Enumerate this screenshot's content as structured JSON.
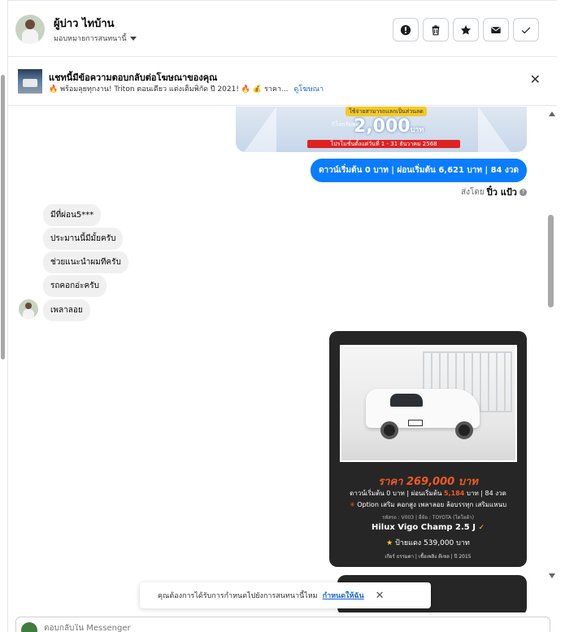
{
  "header": {
    "contact_name": "ผู้บ่าว ไทบ้าน",
    "assign_label": "มอบหมายการสนทนานี้"
  },
  "ad_banner": {
    "title": "แชทนี้มีข้อความตอบกลับต่อโฆษณาของคุณ",
    "subtitle": "🔥 พร้อมลุยทุกงาน! Triton ตอนเดียว แต่งเต็มพิกัด ปี 2021! 🔥 💰 ราคา...",
    "link": "ดูโฆษณา"
  },
  "promo_image": {
    "ribbon": "ใช้จ่ายสามารถแลกเป็นส่วนลด",
    "amount_prefix": "กิโลกรัมละ",
    "amount": "2,000",
    "amount_unit": "บาท",
    "period": "โปรโมชั่นตั้งแต่วันที่ 1 - 31 ธันวาคม 2568"
  },
  "messages": {
    "outgoing_text": "ดาวน์เริ่มต้น 0 บาท | ผ่อนเริ่มต้น 6,621 บาท | 84 งวด",
    "sent_by_label": "ส่งโดย",
    "sent_by_name": "ปิ๋ว แป้ว",
    "incoming": [
      "มีที่ผ่อน5***",
      "ประมานนี้มีมั้ยครับ",
      "ช่วยแนะนำผมทีครับ",
      "รถคอกอ่ะครับ",
      "เพลาลอย"
    ]
  },
  "car_card": {
    "price": "ราคา 269,000 บาท",
    "down_text": "ดาวน์เริ่มต้น 0 บาท | ผ่อนเริ่มต้น",
    "monthly": "5,184",
    "monthly_suffix": "บาท | 84 งวด",
    "option_text": "Option เสริม คอกสูง เพลาลอย ล้อบรรทุก เสริมแหนบ",
    "meta": "รหัสรถ : V003 | ยี่ห้อ : TOYOTA (โตโยต้า)",
    "model": "Hilux Vigo Champ 2.5 J",
    "plate_tag": "ป้ายแดง 539,000 บาท",
    "footer": "เกียร์ ธรรมดา | เชื้อเพลิง ดีเซล | ปี 2015"
  },
  "toast": {
    "text": "คุณต้องการได้รับการกำหนดไปยังการสนทนานี้ไหม",
    "link": "กำหนดให้ฉัน"
  },
  "composer": {
    "placeholder": "ตอบกลับใน Messenger"
  },
  "icons": {
    "report": "alert-circle-icon",
    "delete": "trash-icon",
    "star": "star-icon",
    "mail": "envelope-icon",
    "done": "check-icon"
  },
  "colors": {
    "outgoing_bubble": "#0a7cff",
    "incoming_bubble": "#f0f0f0",
    "card_bg": "#262626",
    "price_orange": "#f15a24",
    "link_blue": "#1a66d8"
  }
}
